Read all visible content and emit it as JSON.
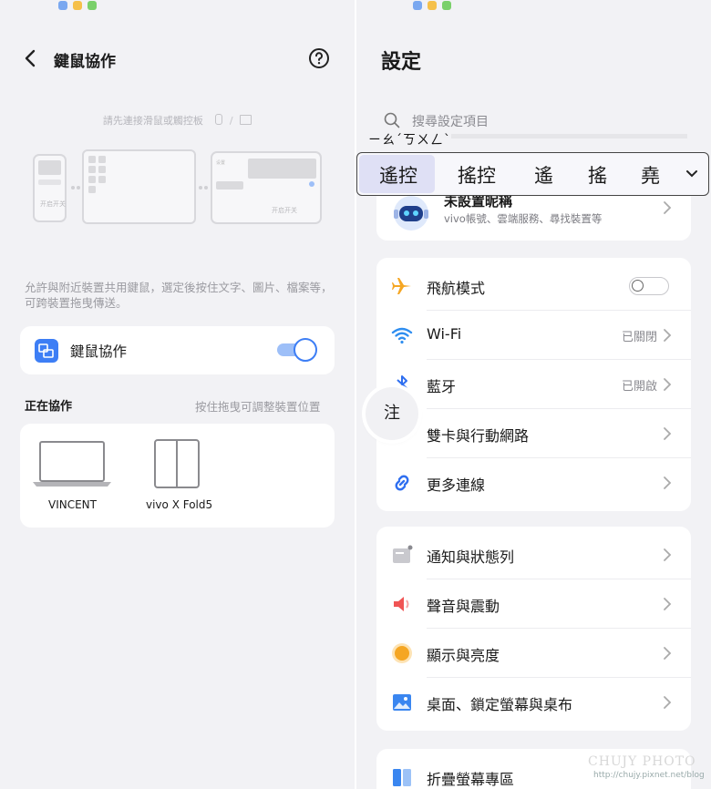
{
  "left": {
    "title": "鍵鼠協作",
    "connect_hint": "請先連接滑鼠或觸控板",
    "illus_left_text": "开启开关",
    "illus_right_text": "开启开关",
    "description": "允許與附近裝置共用鍵鼠，選定後按住文字、圖片、檔案等，可跨裝置拖曳傳送。",
    "kvm_label": "鍵鼠協作",
    "kvm_enabled": true,
    "section_title": "正在協作",
    "section_hint": "按住拖曳可調整裝置位置",
    "devices": [
      {
        "name": "VINCENT",
        "icon": "laptop-icon"
      },
      {
        "name": "vivo X Fold5",
        "icon": "foldable-phone-icon"
      }
    ]
  },
  "right": {
    "title": "設定",
    "search_placeholder": "搜尋設定項目",
    "ime": {
      "composition": "ㄧㄠˊㄎㄨㄥˋ",
      "candidates": [
        "遙控",
        "搖控",
        "遙",
        "搖",
        "堯"
      ],
      "selected": 0
    },
    "profile": {
      "name": "未設置昵稱",
      "subtitle": "vivo帳號、雲端服務、尋找裝置等"
    },
    "group1": [
      {
        "label": "飛航模式",
        "icon": "airplane-icon",
        "type": "toggle",
        "on": false
      },
      {
        "label": "Wi-Fi",
        "icon": "wifi-icon",
        "value": "已關閉"
      },
      {
        "label": "藍牙",
        "icon": "bluetooth-icon",
        "value": "已開啟"
      },
      {
        "label": "雙卡與行動網路",
        "icon": "sim-card-icon"
      },
      {
        "label": "更多連線",
        "icon": "link-icon"
      }
    ],
    "group2": [
      {
        "label": "通知與狀態列",
        "icon": "notification-icon"
      },
      {
        "label": "聲音與震動",
        "icon": "speaker-icon"
      },
      {
        "label": "顯示與亮度",
        "icon": "brightness-icon"
      },
      {
        "label": "桌面、鎖定螢幕與桌布",
        "icon": "wallpaper-icon"
      }
    ],
    "group3": [
      {
        "label": "折疊螢幕專區",
        "icon": "fold-screen-icon"
      }
    ],
    "bubble_char": "注"
  },
  "watermark": {
    "line1": "CHUJY PHOTO",
    "line2": "http://chujy.pixnet.net/blog"
  },
  "colors": {
    "accent": "#3d7ef5",
    "airplane": "#f5a623",
    "wifi": "#2f8ef0",
    "sound": "#f05454",
    "brightness": "#f5a623"
  }
}
